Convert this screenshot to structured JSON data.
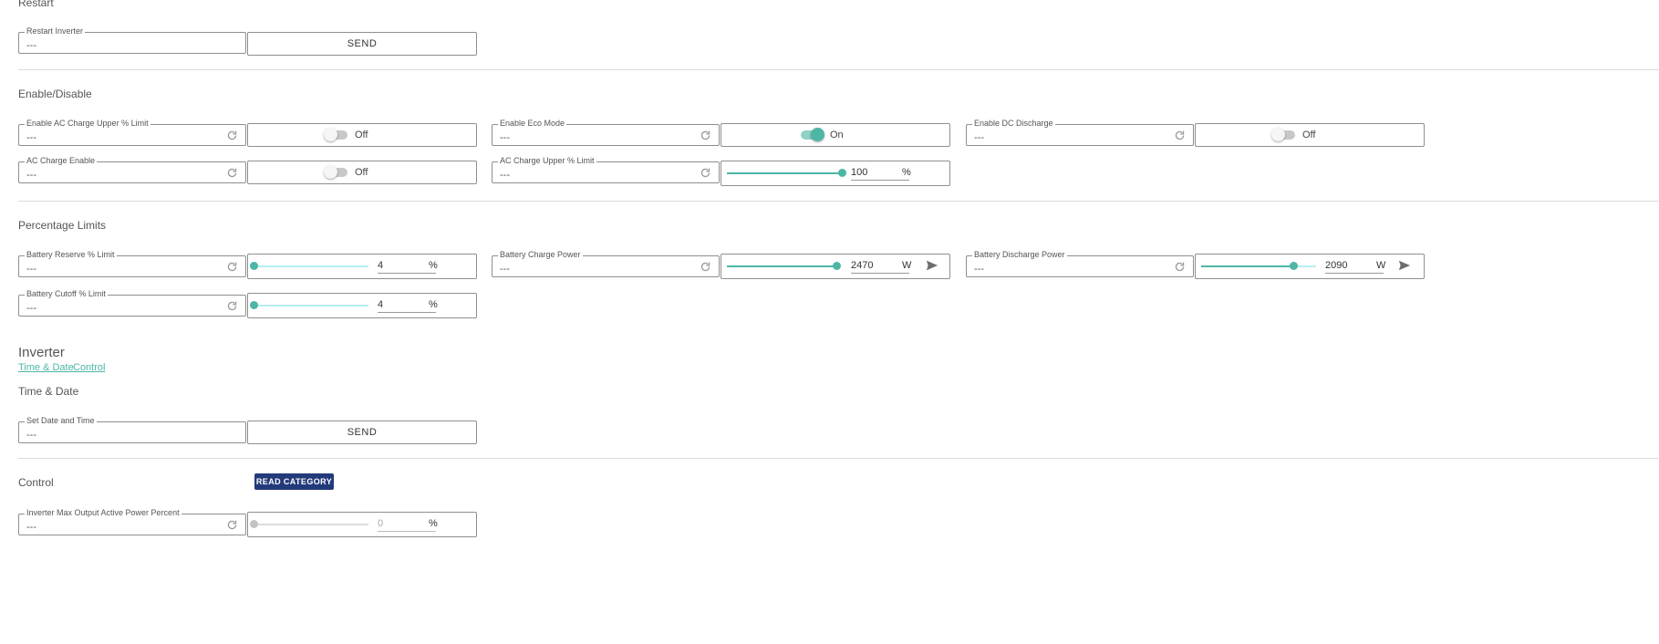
{
  "restart": {
    "title": "Restart",
    "restart_inverter": {
      "legend": "Restart Inverter",
      "value": "---",
      "button": "SEND"
    }
  },
  "enable_disable": {
    "title": "Enable/Disable",
    "enable_ac_charge_upper": {
      "legend": "Enable AC Charge Upper % Limit",
      "value": "---",
      "state": "Off"
    },
    "enable_eco_mode": {
      "legend": "Enable Eco Mode",
      "value": "---",
      "state": "On"
    },
    "enable_dc_discharge": {
      "legend": "Enable DC Discharge",
      "value": "---",
      "state": "Off"
    },
    "ac_charge_enable": {
      "legend": "AC Charge Enable",
      "value": "---",
      "state": "Off"
    },
    "ac_charge_upper_limit": {
      "legend": "AC Charge Upper % Limit",
      "value": "---",
      "input": "100",
      "unit": "%",
      "level_percent": 100
    }
  },
  "percentage_limits": {
    "title": "Percentage Limits",
    "battery_reserve": {
      "legend": "Battery Reserve % Limit",
      "value": "---",
      "input": "4",
      "unit": "%",
      "level_percent": 0
    },
    "battery_charge_power": {
      "legend": "Battery Charge Power",
      "value": "---",
      "input": "2470",
      "unit": "W",
      "level_percent": 100
    },
    "battery_discharge_power": {
      "legend": "Battery Discharge Power",
      "value": "---",
      "input": "2090",
      "unit": "W",
      "level_percent": 80
    },
    "battery_cutoff": {
      "legend": "Battery Cutoff % Limit",
      "value": "---",
      "input": "4",
      "unit": "%",
      "level_percent": 0
    }
  },
  "inverter": {
    "title": "Inverter",
    "links": [
      "Time & Date",
      "Control"
    ]
  },
  "time_date": {
    "title": "Time & Date",
    "set_date_time": {
      "legend": "Set Date and Time",
      "value": "---",
      "button": "SEND"
    }
  },
  "control": {
    "title": "Control",
    "read_button": "READ CATEGORY",
    "max_output": {
      "legend": "Inverter Max Output Active Power Percent",
      "value": "---",
      "input": "0",
      "unit": "%",
      "level_percent": 0
    }
  },
  "colors": {
    "accent": "#4db6a5",
    "rail": "#b9efef",
    "primary_button": "#233a7a"
  },
  "icons": {
    "refresh": "refresh-icon",
    "send": "send-icon"
  }
}
